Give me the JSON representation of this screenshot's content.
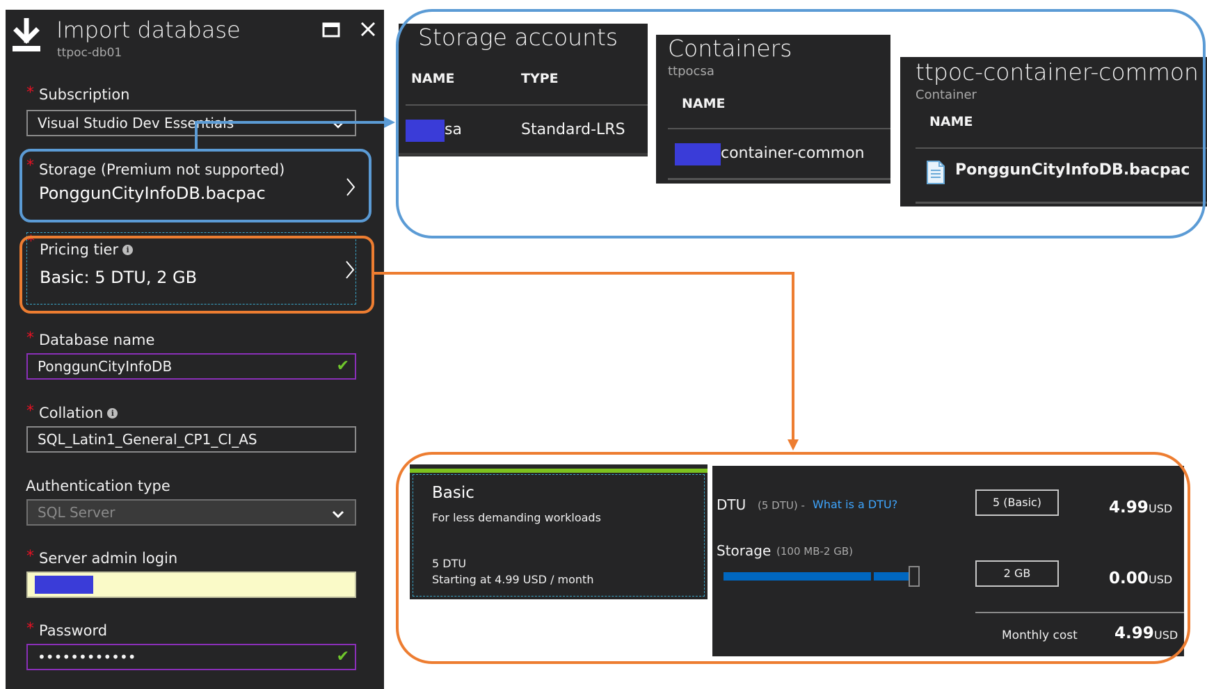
{
  "blade": {
    "title": "Import database",
    "subtitle": "ttpoc-db01",
    "icons": {
      "import": "download-icon",
      "maximize": "maximize-icon",
      "close": "close-icon"
    },
    "subscription": {
      "label": "Subscription",
      "value": "Visual Studio Dev Essentials"
    },
    "storage": {
      "label": "Storage (Premium not supported)",
      "value": "PonggunCityInfoDB.bacpac"
    },
    "pricing_tier": {
      "label": "Pricing tier",
      "value": "Basic: 5 DTU, 2 GB"
    },
    "database_name": {
      "label": "Database name",
      "value": "PonggunCityInfoDB"
    },
    "collation": {
      "label": "Collation",
      "value": "SQL_Latin1_General_CP1_CI_AS"
    },
    "authentication_type": {
      "label": "Authentication type",
      "value": "SQL Server"
    },
    "server_admin_login": {
      "label": "Server admin login",
      "value": ""
    },
    "password": {
      "label": "Password",
      "value": "••••••••••••"
    },
    "required_marker": "*"
  },
  "storage_accounts": {
    "title": "Storage accounts",
    "columns": [
      "NAME",
      "TYPE"
    ],
    "rows": [
      {
        "name_suffix": "sa",
        "type": "Standard-LRS"
      }
    ]
  },
  "containers": {
    "title": "Containers",
    "subtitle": "ttpocsa",
    "columns": [
      "NAME"
    ],
    "rows": [
      {
        "name_suffix": "container-common"
      }
    ]
  },
  "container_blobs": {
    "title": "ttpoc-container-common",
    "subtitle": "Container",
    "columns": [
      "NAME"
    ],
    "rows": [
      {
        "name": "PonggunCityInfoDB.bacpac",
        "icon": "file-icon"
      }
    ]
  },
  "pricing": {
    "tier": {
      "name": "Basic",
      "description": "For less demanding workloads",
      "dtu": "5 DTU",
      "starting": "Starting at 4.99 USD / month"
    },
    "dtu": {
      "label": "DTU",
      "range": "(5 DTU) -",
      "link": "What is a DTU?",
      "selected": "5 (Basic)",
      "price": "4.99",
      "currency": "USD"
    },
    "storage": {
      "label": "Storage",
      "range": "(100 MB-2 GB)",
      "selected": "2 GB",
      "price": "0.00",
      "currency": "USD",
      "slider_level": 1.0
    },
    "monthly": {
      "label": "Monthly cost",
      "price": "4.99",
      "currency": "USD"
    }
  },
  "colors": {
    "panel_bg": "#252526",
    "storage_callout": "#5b9bd5",
    "pricing_callout": "#ed7d31",
    "valid_border": "#8a2fb8",
    "check": "#6fc72c",
    "link": "#3ea6ff",
    "tier_accent": "#7dc21e",
    "slider": "#0067c0",
    "redaction": "#3a3cd8"
  }
}
